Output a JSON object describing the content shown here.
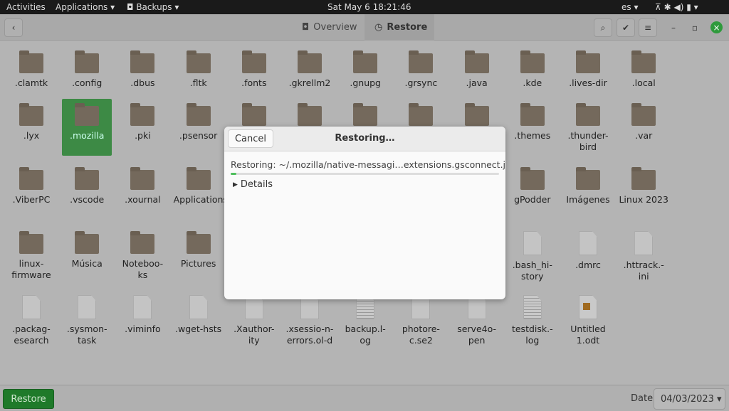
{
  "topbar": {
    "activities": "Activities",
    "applications": "Applications ▾",
    "app": "Backups ▾",
    "clock": "Sat May 6  18:21:46",
    "lang": "es ▾",
    "status_icons": "⊼ ✱ ◀) ▮ ▾"
  },
  "header": {
    "back": "‹",
    "tabs": [
      {
        "icon": "◘",
        "label": "Overview"
      },
      {
        "icon": "◷",
        "label": "Restore"
      }
    ],
    "search": "⌕",
    "select": "✔",
    "menu": "≡",
    "minimize": "–",
    "maximize": "▫",
    "close": "×"
  },
  "files": [
    [
      {
        "n": ".clamtk",
        "t": "folder"
      },
      {
        "n": ".config",
        "t": "folder"
      },
      {
        "n": ".dbus",
        "t": "folder"
      },
      {
        "n": ".fltk",
        "t": "folder"
      },
      {
        "n": ".fonts",
        "t": "folder"
      },
      {
        "n": ".gkrellm2",
        "t": "folder"
      },
      {
        "n": ".gnupg",
        "t": "folder"
      },
      {
        "n": ".grsync",
        "t": "folder"
      },
      {
        "n": ".java",
        "t": "folder"
      },
      {
        "n": ".kde",
        "t": "folder"
      },
      {
        "n": ".lives-dir",
        "t": "folder"
      },
      {
        "n": ".local",
        "t": "folder"
      }
    ],
    [
      {
        "n": ".lyx",
        "t": "folder"
      },
      {
        "n": ".mozilla",
        "t": "folder",
        "selected": true
      },
      {
        "n": ".pki",
        "t": "folder"
      },
      {
        "n": ".psensor",
        "t": "folder"
      },
      {
        "n": "",
        "t": "folder"
      },
      {
        "n": "",
        "t": "folder"
      },
      {
        "n": "",
        "t": "folder"
      },
      {
        "n": "",
        "t": "folder"
      },
      {
        "n": "",
        "t": "folder"
      },
      {
        "n": ".themes",
        "t": "folder"
      },
      {
        "n": ".thunder-bird",
        "t": "folder"
      },
      {
        "n": ".var",
        "t": "folder"
      }
    ],
    [
      {
        "n": ".ViberPC",
        "t": "folder"
      },
      {
        "n": ".vscode",
        "t": "folder"
      },
      {
        "n": ".xournal",
        "t": "folder"
      },
      {
        "n": "Applications",
        "t": "folder"
      },
      null,
      null,
      null,
      null,
      null,
      {
        "n": "gPodder",
        "t": "folder"
      },
      {
        "n": "Imágenes",
        "t": "folder"
      },
      {
        "n": "Linux 2023",
        "t": "folder"
      }
    ],
    [
      {
        "n": "linux-firmware",
        "t": "folder"
      },
      {
        "n": "Música",
        "t": "folder"
      },
      {
        "n": "Noteboo-ks",
        "t": "folder"
      },
      {
        "n": "Pictures",
        "t": "folder"
      },
      null,
      null,
      null,
      null,
      null,
      {
        "n": ".bash_hi-story",
        "t": "file"
      },
      {
        "n": ".dmrc",
        "t": "file"
      },
      {
        "n": ".httrack.-ini",
        "t": "file"
      }
    ],
    [
      {
        "n": ".packag-esearch",
        "t": "file"
      },
      {
        "n": ".sysmon-task",
        "t": "file"
      },
      {
        "n": ".viminfo",
        "t": "file"
      },
      {
        "n": ".wget-hsts",
        "t": "file"
      },
      {
        "n": ".Xauthor-ity",
        "t": "file"
      },
      {
        "n": ".xsessio-n-errors.ol-d",
        "t": "file"
      },
      {
        "n": "backup.l-og",
        "t": "txt"
      },
      {
        "n": "photore-c.se2",
        "t": "file"
      },
      {
        "n": "serve4o-pen",
        "t": "file"
      },
      {
        "n": "testdisk.-log",
        "t": "txt"
      },
      {
        "n": "Untitled 1.odt",
        "t": "odt"
      }
    ]
  ],
  "dialog": {
    "cancel": "Cancel",
    "title": "Restoring…",
    "status": "Restoring: ~/.mozilla/native-messagi…extensions.gsconnect.json",
    "progress": 0.02,
    "details": "Details"
  },
  "footer": {
    "restore": "Restore",
    "date_label": "Date",
    "date_value": "04/03/2023 ▾"
  }
}
